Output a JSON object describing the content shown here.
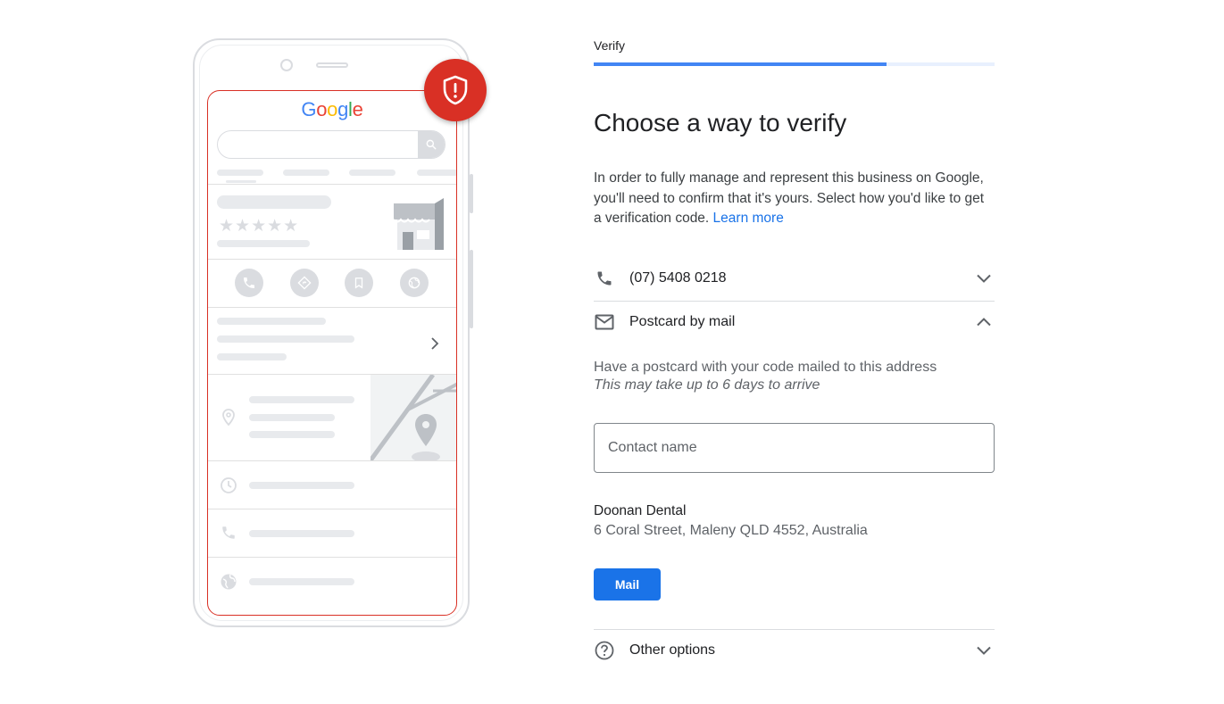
{
  "illustration": {
    "logo_letters": [
      "G",
      "o",
      "o",
      "g",
      "l",
      "e"
    ],
    "logo_colors": [
      "#4285f4",
      "#ea4335",
      "#fbbc05",
      "#4285f4",
      "#34a853",
      "#ea4335"
    ],
    "stars": "★★★★★",
    "badge_icon": "shield-alert-icon",
    "badge_color": "#d93025"
  },
  "header": {
    "step_label": "Verify",
    "progress_fraction": 0.73
  },
  "main": {
    "title": "Choose a way to verify",
    "intro_text": "In order to fully manage and represent this business on Google, you'll need to confirm that it's yours. Select how you'd like to get a verification code. ",
    "learn_more": "Learn more",
    "options": {
      "phone": {
        "label": "(07) 5408 0218",
        "icon": "phone-icon",
        "expanded": false
      },
      "postcard": {
        "label": "Postcard by mail",
        "icon": "mail-icon",
        "expanded": true
      },
      "other": {
        "label": "Other options",
        "icon": "help-circle-icon",
        "expanded": false
      }
    },
    "postcard": {
      "description": "Have a postcard with your code mailed to this address",
      "note": "This may take up to 6 days to arrive",
      "contact_placeholder": "Contact name",
      "contact_value": "",
      "business_name": "Doonan Dental",
      "address": "6 Coral Street, Maleny QLD 4552, Australia",
      "mail_button": "Mail"
    }
  },
  "colors": {
    "accent": "#1a73e8",
    "progress": "#4285f4",
    "alert": "#d93025"
  }
}
